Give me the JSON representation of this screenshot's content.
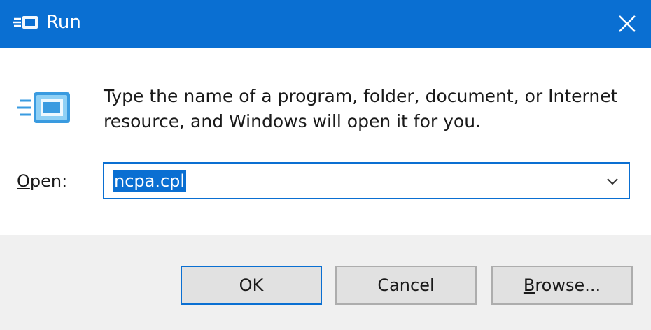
{
  "window": {
    "title": "Run",
    "icon": "run-icon",
    "accent_color": "#0a6fd2"
  },
  "dialog": {
    "description": "Type the name of a program, folder, document, or Internet resource, and Windows will open it for you.",
    "open_label": {
      "accesskey": "O",
      "rest": "pen:"
    },
    "input": {
      "value": "ncpa.cpl"
    }
  },
  "buttons": {
    "ok": "OK",
    "cancel": "Cancel",
    "browse": {
      "accesskey": "B",
      "rest": "rowse..."
    }
  }
}
